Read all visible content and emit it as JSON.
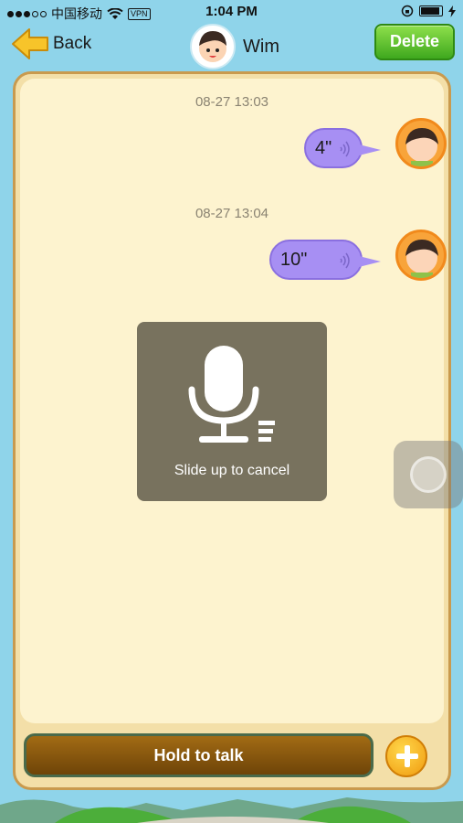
{
  "status_bar": {
    "carrier": "中国移动",
    "vpn_label": "VPN",
    "time": "1:04 PM"
  },
  "nav": {
    "back_label": "Back",
    "contact_name": "Wim",
    "delete_label": "Delete"
  },
  "messages": [
    {
      "timestamp": "08-27 13:03",
      "duration": "4\""
    },
    {
      "timestamp": "08-27 13:04",
      "duration": "10\""
    }
  ],
  "recording": {
    "hint": "Slide up to cancel"
  },
  "footer": {
    "talk_label": "Hold to talk"
  },
  "colors": {
    "background": "#8fd4ea",
    "bubble": "#a78ff3",
    "delete_button": "#4cb526",
    "talk_button": "#8a5810",
    "plus_button": "#f7b82a"
  },
  "icons": [
    "back-arrow-icon",
    "wifi-icon",
    "microphone-icon",
    "plus-icon",
    "voice-wave-icon"
  ]
}
